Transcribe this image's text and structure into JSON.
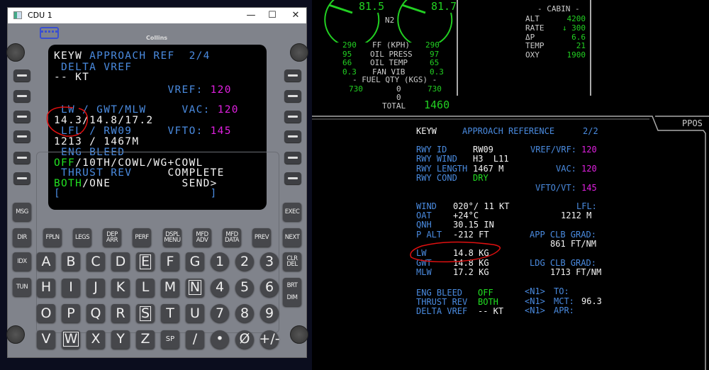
{
  "window": {
    "title": "CDU 1",
    "minimize": "—",
    "maximize": "☐",
    "close": "✕",
    "brand": "Collins"
  },
  "cdu": {
    "lines": [
      [
        {
          "t": "KEYW ",
          "c": "w"
        },
        {
          "t": "APPROACH REF  2/4",
          "c": "b"
        }
      ],
      [
        {
          "t": " DELTA VREF",
          "c": "b"
        }
      ],
      [
        {
          "t": "-- KT",
          "c": "w"
        }
      ],
      [
        {
          "t": "                VREF: ",
          "c": "b"
        },
        {
          "t": "120",
          "c": "m"
        }
      ],
      [
        {
          "t": " LW / GWT/MLW",
          "c": "b"
        },
        {
          "t": "     VAC: ",
          "c": "b"
        },
        {
          "t": "120",
          "c": "m"
        }
      ],
      [
        {
          "t": "14.3/14.8/17.2",
          "c": "w"
        }
      ],
      [
        {
          "t": " LFL / RW09",
          "c": "b"
        },
        {
          "t": "     VFTO: ",
          "c": "b"
        },
        {
          "t": "145",
          "c": "m"
        }
      ],
      [
        {
          "t": "1213 / 1467M",
          "c": "w"
        }
      ],
      [
        {
          "t": " ENG BLEED",
          "c": "b"
        }
      ],
      [
        {
          "t": "OFF",
          "c": "g"
        },
        {
          "t": "/10TH/COWL/WG+COWL",
          "c": "w"
        }
      ],
      [
        {
          "t": " THRUST REV",
          "c": "b"
        },
        {
          "t": "     COMPLETE",
          "c": "w"
        }
      ],
      [
        {
          "t": "BOTH",
          "c": "g"
        },
        {
          "t": "/ONE",
          "c": "w"
        },
        {
          "t": "          SEND>",
          "c": "w"
        }
      ],
      [
        {
          "t": "[",
          "c": "b"
        },
        {
          "t": "                     ]",
          "c": "b"
        }
      ]
    ],
    "fkeys": [
      "MSG",
      "EXEC",
      "DIR",
      "FPLN",
      "LEGS",
      "DEP\nARR",
      "PERF",
      "DSPL\nMENU",
      "MFD\nADV",
      "MFD\nDATA",
      "PREV",
      "NEXT",
      "IDX",
      "CLR\nDEL",
      "TUN",
      "BRT\n\nDIM"
    ],
    "keyrows": [
      [
        "A",
        "B",
        "C",
        "D",
        "E",
        "F",
        "G",
        "1",
        "2",
        "3"
      ],
      [
        "H",
        "I",
        "J",
        "K",
        "L",
        "M",
        "N",
        "4",
        "5",
        "6"
      ],
      [
        "O",
        "P",
        "Q",
        "R",
        "S",
        "T",
        "U",
        "7",
        "8",
        "9"
      ],
      [
        "V",
        "W",
        "X",
        "Y",
        "Z",
        "SP",
        "/",
        "•",
        "Ø",
        "+/-"
      ]
    ],
    "boxed": [
      "E",
      "N",
      "S",
      "W"
    ]
  },
  "eicas": {
    "n2_left": "81.5",
    "n2_right": "81.7",
    "n2_label": "N2",
    "rows": [
      [
        "290",
        "FF (KPH)",
        "290"
      ],
      [
        "95",
        "OIL PRESS",
        "97"
      ],
      [
        "66",
        "OIL TEMP",
        "65"
      ],
      [
        "0.3",
        "FAN VIB",
        "0.3"
      ]
    ],
    "fuel_label": "- FUEL QTY (KGS) -",
    "fuel_left": "730",
    "fuel_center": "0",
    "fuel_right": "730",
    "fuel_center2": "0",
    "total_label": "TOTAL",
    "total": "1460",
    "cabin_title": "- CABIN -",
    "cabin": [
      [
        "ALT",
        "4200"
      ],
      [
        "RATE",
        "↓ 300"
      ],
      [
        "ΔP",
        "6.6"
      ],
      [
        "TEMP",
        "21"
      ],
      [
        "OXY",
        "1900"
      ]
    ]
  },
  "mfd": {
    "tab": "PPOS",
    "header": {
      "apt": "KEYW",
      "title": "APPROACH REFERENCE",
      "page": "2/2"
    },
    "left": [
      {
        "l": "RWY ID",
        "v": "RW09",
        "vc": "w"
      },
      {
        "l": "RWY WIND",
        "v": "H3  L11",
        "vc": "w"
      },
      {
        "l": "RWY LENGTH",
        "v": "1467 M",
        "vc": "w"
      },
      {
        "l": "RWY COND",
        "v": "DRY",
        "vc": "g"
      },
      {
        "l": "",
        "v": ""
      },
      {
        "l": "",
        "v": ""
      },
      {
        "l": "WIND",
        "v": "020°/ 11 KT",
        "vc": "w"
      },
      {
        "l": "OAT",
        "v": "+24°C",
        "vc": "w"
      },
      {
        "l": "QNH",
        "v": "30.15 IN",
        "vc": "w"
      },
      {
        "l": "P ALT",
        "v": "-212 FT",
        "vc": "w"
      },
      {
        "l": "",
        "v": ""
      },
      {
        "l": "LW",
        "v": "14.8 KG",
        "vc": "w"
      },
      {
        "l": "GWT",
        "v": "14.8 KG",
        "vc": "w"
      },
      {
        "l": "MLW",
        "v": "17.2 KG",
        "vc": "w"
      },
      {
        "l": "",
        "v": ""
      },
      {
        "l": "ENG BLEED",
        "v": "OFF",
        "vc": "g"
      },
      {
        "l": "THRUST REV",
        "v": "BOTH",
        "vc": "g"
      },
      {
        "l": "DELTA VREF",
        "v": "-- KT",
        "vc": "w"
      }
    ],
    "vref_label": "VREF/VRF:",
    "vref": "120",
    "vac_label": "VAC:",
    "vac": "120",
    "vfto_label": "VFTO/VT:",
    "vfto": "145",
    "lfl_label": "LFL:",
    "lfl": "1212 M",
    "app_label": "APP CLB GRAD:",
    "app": "861 FT/NM",
    "ldg_label": "LDG CLB GRAD:",
    "ldg": "1713 FT/NM",
    "n1": [
      [
        "<N1>",
        "TO:",
        ""
      ],
      [
        "<N1>",
        "MCT:",
        "96.3"
      ],
      [
        "<N1>",
        "APR:",
        ""
      ]
    ]
  },
  "colors": {
    "cyan": "#4a8be0",
    "magenta": "#e020e0",
    "green": "#22e022",
    "white": "#f4f4f4",
    "annotation": "#e01010"
  }
}
